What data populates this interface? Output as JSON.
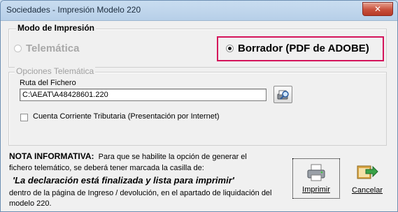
{
  "window": {
    "title": "Sociedades - Impresión Modelo 220",
    "close_glyph": "✕"
  },
  "modo": {
    "legend": "Modo de Impresión",
    "options": [
      {
        "label": "Telemática",
        "selected": false,
        "enabled": false
      },
      {
        "label": "Borrador (PDF de ADOBE)",
        "selected": true,
        "enabled": true
      }
    ],
    "highlight_color": "#d4145a"
  },
  "opciones": {
    "legend": "Opciones Telemática",
    "ruta_label": "Ruta del Fichero",
    "ruta_value": "C:\\AEAT\\A48428601.220",
    "browse_icon": "printer-magnifier-icon",
    "checkbox_label": "Cuenta Corriente Tributaria  (Presentación por Internet)",
    "checkbox_checked": false
  },
  "nota": {
    "heading": "NOTA INFORMATIVA:",
    "line1": "Para que se habilite la opción de generar el",
    "line2": "fichero telemático, se deberá tener marcada la casilla de:",
    "emphasis": "'La declaración está finalizada y lista para imprimir'",
    "line3": "dentro de la página de Ingreso / devolución, en el apartado de liquidación del",
    "line4": "modelo 220."
  },
  "buttons": {
    "imprimir": {
      "label": "Imprimir",
      "icon": "printer-icon"
    },
    "cancelar": {
      "label": "Cancelar",
      "icon": "cancel-arrow-icon"
    }
  }
}
